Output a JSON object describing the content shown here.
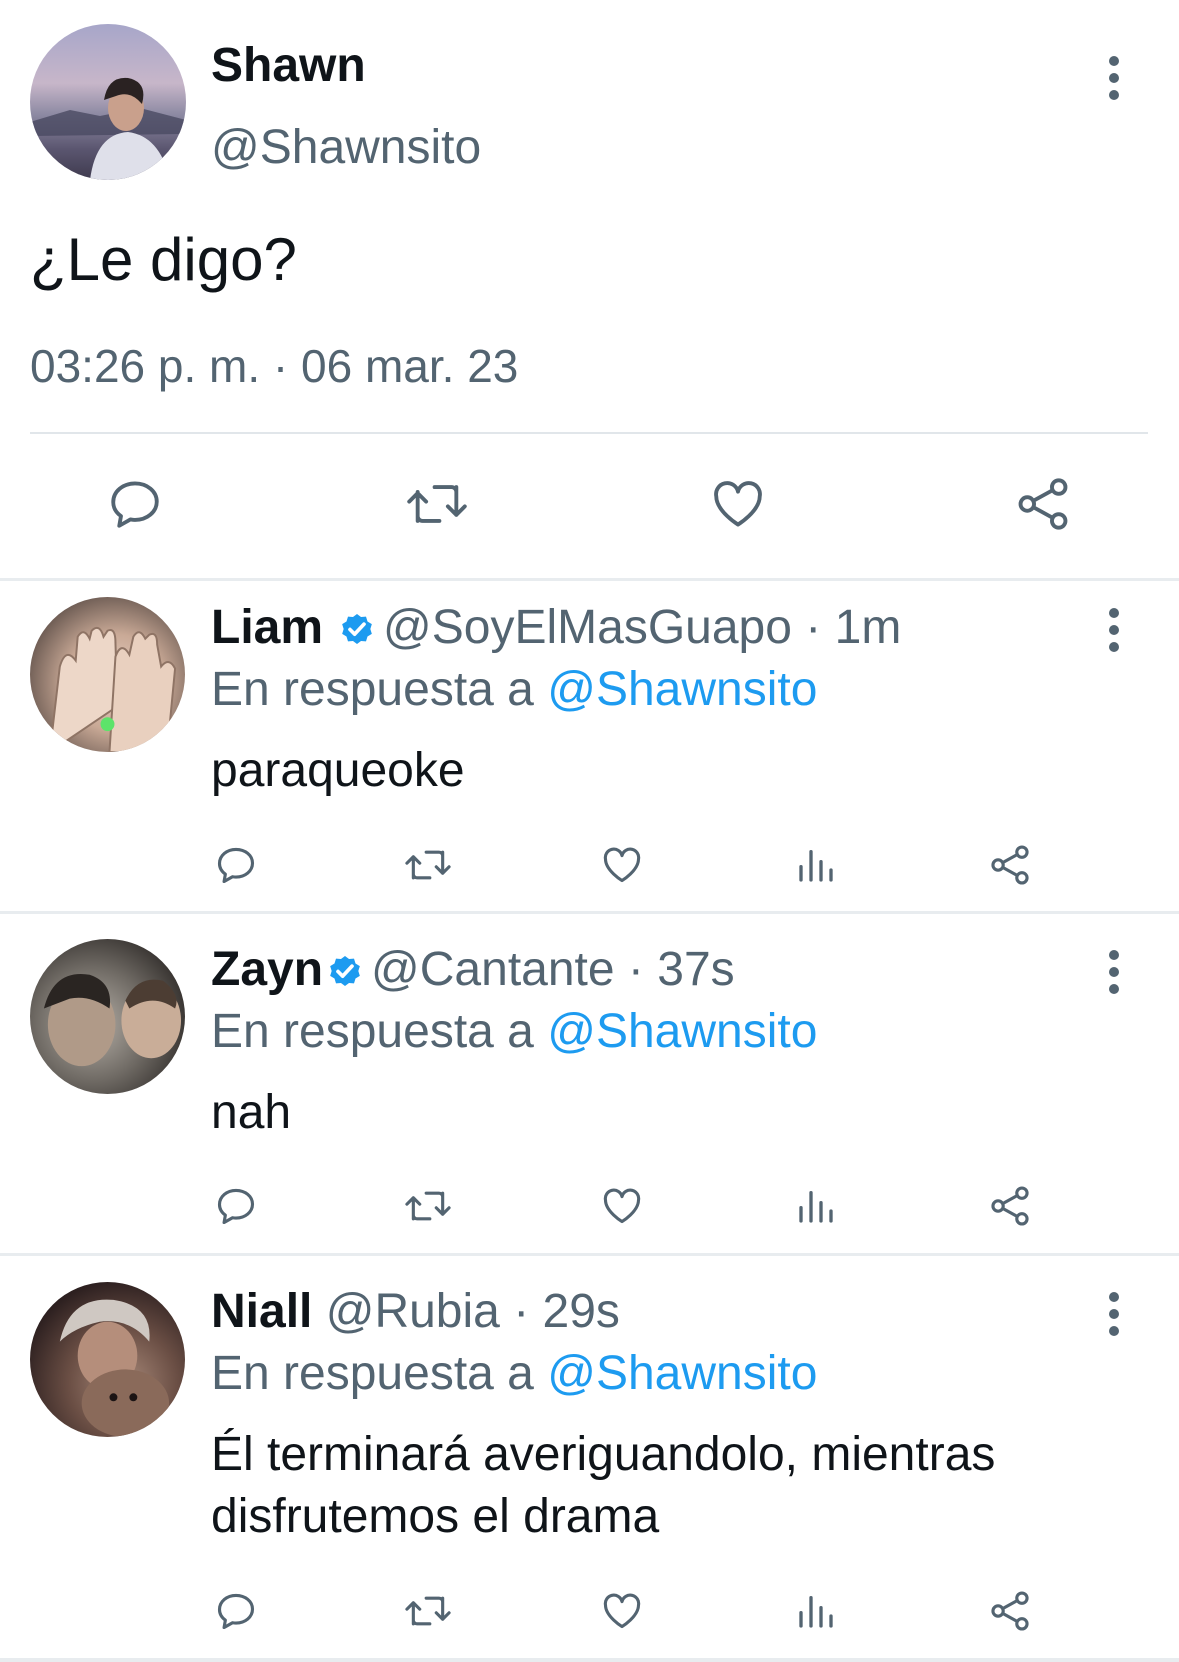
{
  "main_tweet": {
    "display_name": "Shawn",
    "handle": "@Shawnsito",
    "text": "¿Le digo?",
    "timestamp": "03:26 p. m. · 06 mar. 23",
    "actions": [
      "reply-icon",
      "retweet-icon",
      "like-icon",
      "share-icon"
    ]
  },
  "replies": [
    {
      "display_name": "Liam",
      "verified": true,
      "handle": "@SoyElMasGuapo",
      "time": "· 1m",
      "reply_prefix": "En respuesta a ",
      "reply_to": "@Shawnsito",
      "text": "paraqueoke"
    },
    {
      "display_name": "Zayn",
      "verified": true,
      "handle": "@Cantante",
      "time": "· 37s",
      "reply_prefix": "En respuesta a ",
      "reply_to": "@Shawnsito",
      "text": "nah"
    },
    {
      "display_name": "Niall",
      "verified": false,
      "handle": "@Rubia",
      "time": "· 29s",
      "reply_prefix": "En respuesta a ",
      "reply_to": "@Shawnsito",
      "text": "Él terminará averiguandolo, mientras disfrutemos el drama"
    }
  ],
  "colors": {
    "text": "#0f1419",
    "muted": "#536471",
    "link": "#1d9bf0",
    "verified": "#1d9bf0",
    "divider": "#e1e6ea"
  }
}
